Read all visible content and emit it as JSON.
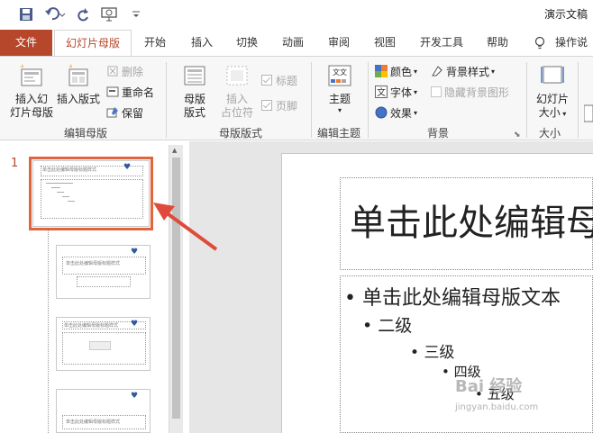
{
  "qat": {
    "title": "演示文稿"
  },
  "tabs": [
    {
      "label": "文件"
    },
    {
      "label": "幻灯片母版"
    },
    {
      "label": "开始"
    },
    {
      "label": "插入"
    },
    {
      "label": "切换"
    },
    {
      "label": "动画"
    },
    {
      "label": "审阅"
    },
    {
      "label": "视图"
    },
    {
      "label": "开发工具"
    },
    {
      "label": "帮助"
    },
    {
      "label": "操作说"
    }
  ],
  "ribbon": {
    "edit_master": {
      "insert_master_1": "插入幻",
      "insert_master_2": "灯片母版",
      "insert_layout": "插入版式",
      "delete": "删除",
      "rename": "重命名",
      "preserve": "保留",
      "group_label": "编辑母版"
    },
    "master_layout": {
      "layout_1": "母版",
      "layout_2": "版式",
      "insert_ph_1": "插入",
      "insert_ph_2": "占位符",
      "title": "标题",
      "footer": "页脚",
      "group_label": "母版版式"
    },
    "edit_theme": {
      "theme": "主题",
      "group_label": "编辑主题"
    },
    "background": {
      "colors": "颜色",
      "fonts": "字体",
      "effects": "效果",
      "bg_styles": "背景样式",
      "hide_bg": "隐藏背景图形",
      "group_label": "背景"
    },
    "size": {
      "slide_size_1": "幻灯片",
      "slide_size_2": "大小",
      "group_label": "大小"
    }
  },
  "thumbnails": {
    "selected_number": "1",
    "slide1_title": "单击此处编辑母版标题样式",
    "slide2_title": "单击此处编辑母版标题样式",
    "slide3_title": "单击此处编辑母版标题样式",
    "slide4_title": "单击此处编辑母版标题样式"
  },
  "slide": {
    "title": "单击此处编辑母",
    "level1": "单击此处编辑母版文本",
    "level2": "二级",
    "level3": "三级",
    "level4": "四级",
    "level5": "五级"
  },
  "watermark": {
    "text": "Bai 经验",
    "url": "jingyan.baidu.com"
  },
  "colors": {
    "accent": "#b7472a",
    "arrow": "#e04a3a"
  }
}
